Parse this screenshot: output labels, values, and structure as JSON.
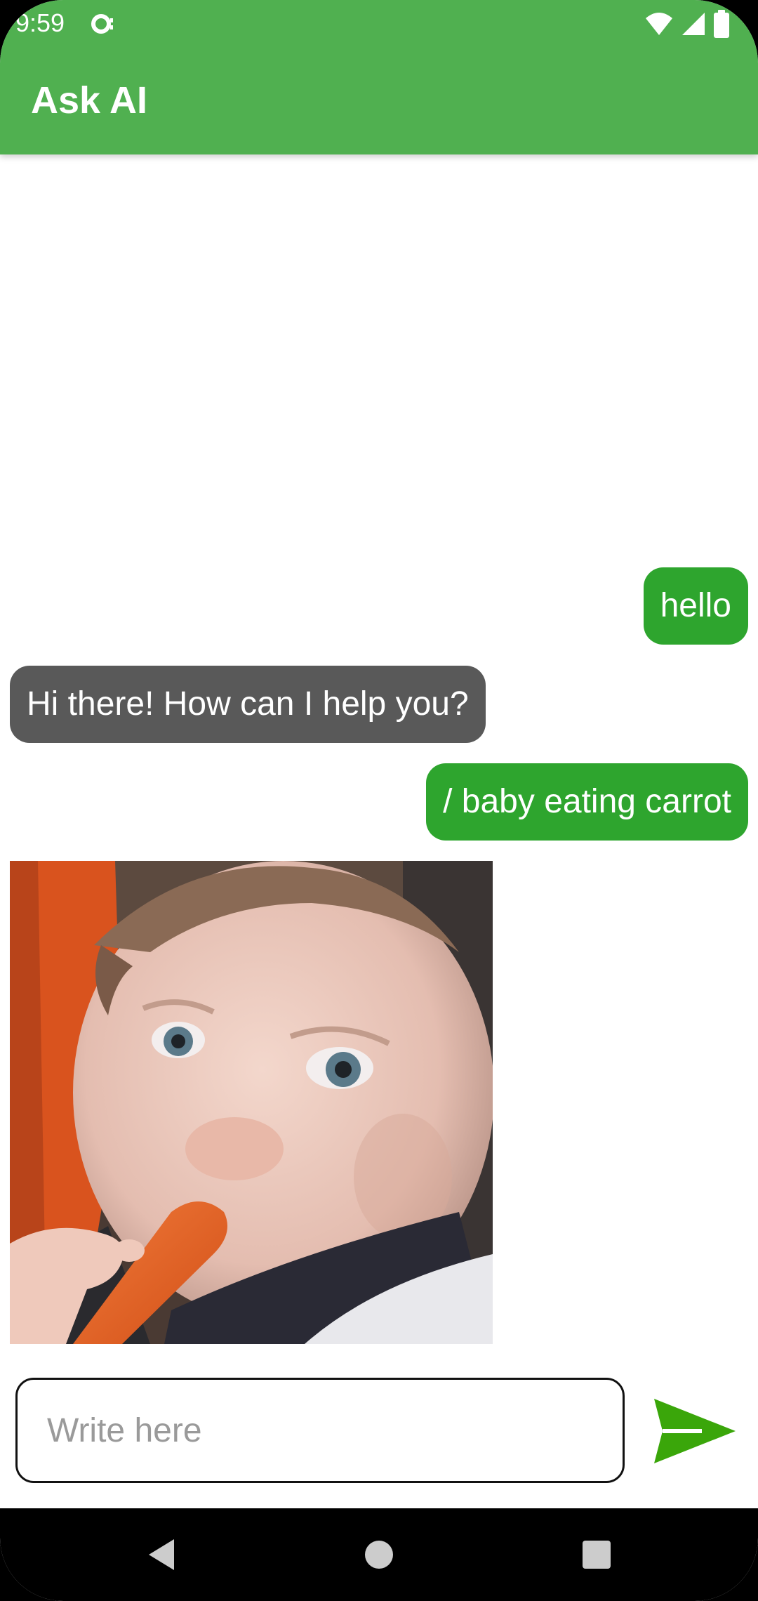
{
  "status_bar": {
    "time": "9:59"
  },
  "app_bar": {
    "title": "Ask AI",
    "color": "#50b050"
  },
  "messages": [
    {
      "role": "user",
      "text": "hello"
    },
    {
      "role": "bot",
      "text": "Hi there! How can I help you?"
    },
    {
      "role": "user",
      "text": "/ baby eating carrot"
    },
    {
      "role": "bot",
      "type": "image",
      "icon": "generated-image"
    }
  ],
  "composer": {
    "placeholder": "Write here",
    "send_icon": "send-icon"
  },
  "colors": {
    "user_bubble": "#2ea52e",
    "bot_bubble": "#595959",
    "send": "#3aa60a"
  },
  "nav": {
    "back_icon": "back-triangle-icon",
    "home_icon": "home-circle-icon",
    "recents_icon": "recents-square-icon"
  }
}
